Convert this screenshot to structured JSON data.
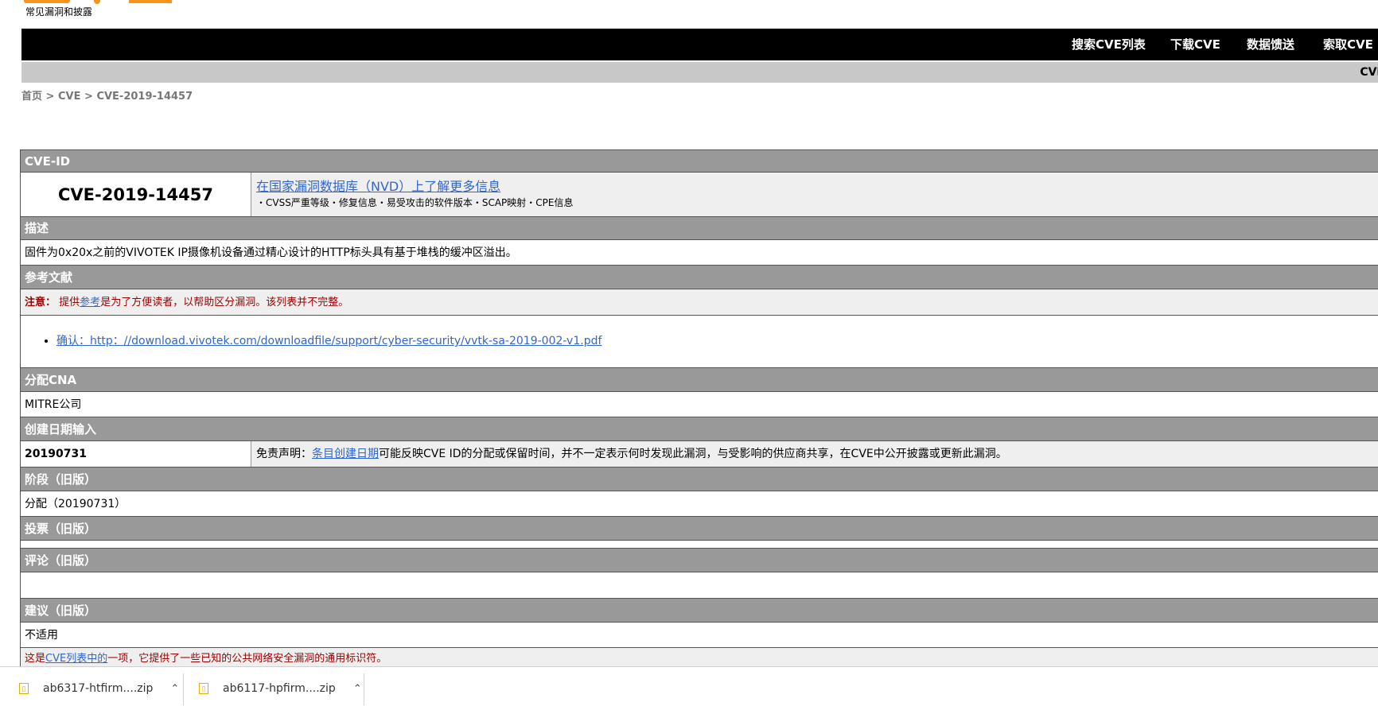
{
  "logo": {
    "tagline": "常见漏洞和披露"
  },
  "topnav": {
    "items": [
      "搜索CVE列表",
      "下载CVE",
      "数据馈送",
      "索取CVE ID"
    ]
  },
  "subnav": {
    "label": "CVE"
  },
  "breadcrumb": {
    "home": "首页",
    "sep1": ">",
    "cve": "CVE",
    "sep2": ">",
    "current": "CVE-2019-14457"
  },
  "record": {
    "id_header": "CVE-ID",
    "id": "CVE-2019-14457",
    "nvd_link": "在国家漏洞数据库（NVD）上了解更多信息",
    "nvd_sub": "・CVSS严重等级・修复信息・易受攻击的软件版本・SCAP映射・CPE信息",
    "desc_header": "描述",
    "description": "固件为0x20x之前的VIVOTEK IP摄像机设备通过精心设计的HTTP标头具有基于堆栈的缓冲区溢出。",
    "refs_header": "参考文献",
    "refs_note_label": "注意：",
    "refs_note_pre": "提供",
    "refs_note_link": "参考",
    "refs_note_post": "是为了方便读者，以帮助区分漏洞。该列表并不完整。",
    "refs": [
      "确认：http：//download.vivotek.com/downloadfile/support/cyber-security/vvtk-sa-2019-002-v1.pdf"
    ],
    "cna_header": "分配CNA",
    "cna": "MITRE公司",
    "date_header": "创建日期输入",
    "date": "20190731",
    "disclaimer_pre": "免责声明：",
    "disclaimer_link": "条目创建日期",
    "disclaimer_post": "可能反映CVE ID的分配或保留时间，并不一定表示何时发现此漏洞，与受影响的供应商共享，在CVE中公开披露或更新此漏洞。",
    "phase_header": "阶段（旧版）",
    "phase": "分配（20190731）",
    "votes_header": "投票（旧版）",
    "comments_header": "评论（旧版）",
    "proposal_header": "建议（旧版）",
    "proposal": "不适用",
    "footer_pre": "这是",
    "footer_link": "CVE列表中的",
    "footer_post": "一项，它提供了一些已知的公共网络安全漏洞的通用标识符。"
  },
  "downloads": [
    {
      "name": "ab6317-htfirm....zip"
    },
    {
      "name": "ab6117-hpfirm....zip"
    }
  ]
}
